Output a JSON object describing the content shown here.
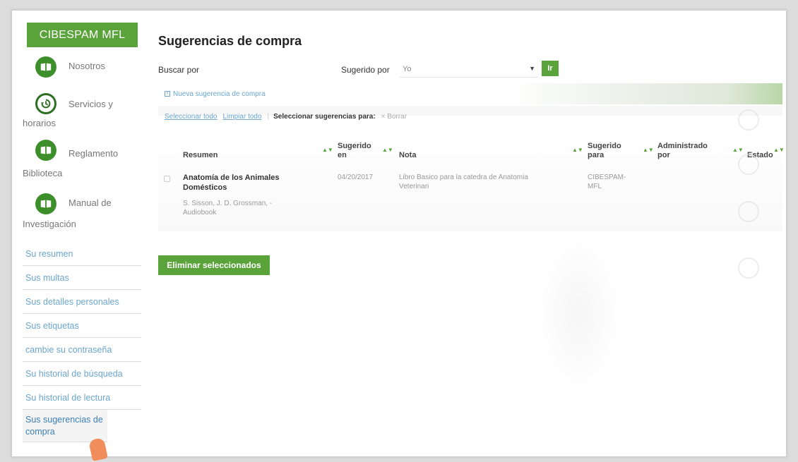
{
  "brand": "CIBESPAM MFL",
  "quick_links": [
    {
      "line1": "Nosotros",
      "line2": "",
      "icon": "book-icon"
    },
    {
      "line1": "Servicios y",
      "line2": "horarios",
      "icon": "history-icon"
    },
    {
      "line1": "Reglamento",
      "line2": "Biblioteca",
      "icon": "book-icon"
    },
    {
      "line1": "Manual de",
      "line2": "Investigación",
      "icon": "book-icon"
    }
  ],
  "menu": [
    "Su resumen",
    "Sus multas",
    "Sus detalles personales",
    "Sus etiquetas",
    "cambie su contraseña",
    "Su historial de búsqueda",
    "Su historial de lectura",
    "Sus sugerencias de compra"
  ],
  "page": {
    "title": "Sugerencias de compra",
    "search_label": "Buscar por",
    "suggested_by_label": "Sugerido por",
    "suggested_by_value": "Yo",
    "go_label": "Ir",
    "new_suggestion": "Nueva sugerencia de compra",
    "select_all": "Seleccionar todo",
    "clear_all": "Limpiar todo",
    "select_for": "Seleccionar sugerencias para:",
    "delete_link": "× Borrar",
    "delete_selected": "Eliminar seleccionados"
  },
  "table": {
    "headers": {
      "summary": "Resumen",
      "suggested_on_1": "Sugerido",
      "suggested_on_2": "en",
      "note": "Nota",
      "suggested_for_1": "Sugerido",
      "suggested_for_2": "para",
      "managed_by_1": "Administrado",
      "managed_by_2": "por",
      "status": "Estado"
    },
    "rows": [
      {
        "title_1": "Anatomía de los Animales",
        "title_2": "Domésticos",
        "author_1": "S. Sisson, J. D. Grossman, -",
        "author_2": "Audiobook",
        "date": "04/20/2017",
        "note_1": "Libro Basico para la catedra de Anatomia",
        "note_2": "Veterinari",
        "suggested_for_1": "CIBESPAM-",
        "suggested_for_2": "MFL"
      }
    ]
  },
  "colors": {
    "accent": "#5aa33b",
    "link": "#6aa6cf"
  }
}
